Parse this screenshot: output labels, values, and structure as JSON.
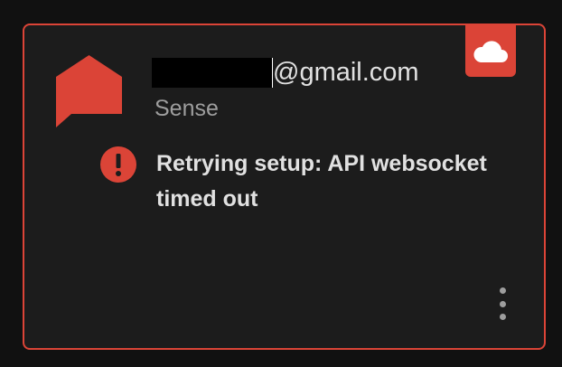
{
  "card": {
    "account_suffix": "@gmail.com",
    "integration_name": "Sense",
    "error_message": "Retrying setup: API websocket timed out"
  },
  "icons": {
    "logo": "sense-logo-icon",
    "cloud": "cloud-icon",
    "error": "error-exclamation-icon",
    "menu": "more-vertical-icon"
  },
  "colors": {
    "accent": "#db4437",
    "background": "#111111",
    "card_background": "#1c1c1c",
    "primary_text": "#e1e1e1",
    "secondary_text": "#9e9e9e"
  }
}
